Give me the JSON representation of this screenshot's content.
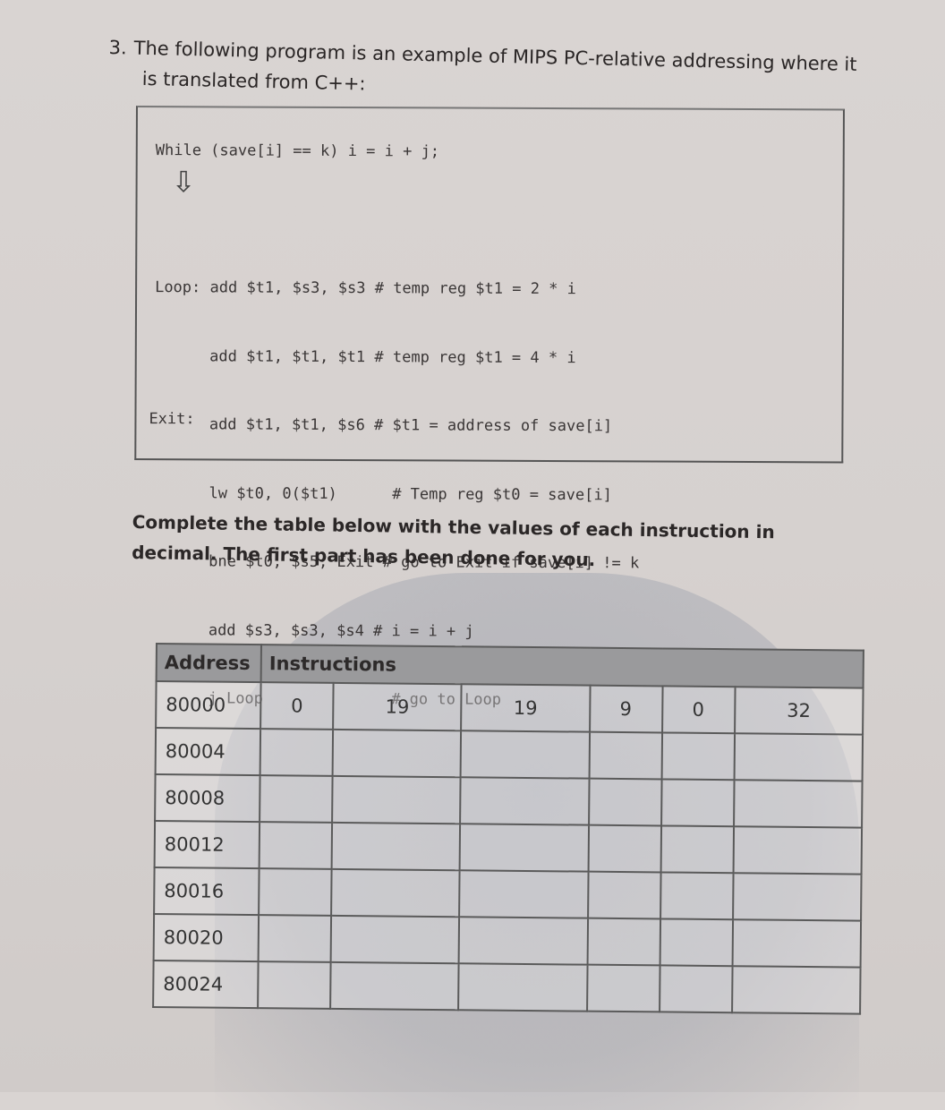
{
  "question": {
    "number": "3.",
    "line1": "The following program is an example of MIPS PC-relative addressing where it",
    "line2": "is translated from C++:"
  },
  "code": {
    "cpp": "While (save[i] == k) i = i + j;",
    "arrow_icon": "down-arrow",
    "asm_lines": [
      "Loop: add $t1, $s3, $s3 # temp reg $t1 = 2 * i",
      "      add $t1, $t1, $t1 # temp reg $t1 = 4 * i",
      "      add $t1, $t1, $s6 # $t1 = address of save[i]",
      "      lw $t0, 0($t1)      # Temp reg $t0 = save[i]",
      "      bne $t0, $s5, Exit # go to Exit if save[i] != k",
      "      add $s3, $s3, $s4 # i = i + j",
      "      j Loop              # go to Loop"
    ],
    "exit_label": "Exit:"
  },
  "instruction_text": "Complete the table below with the values of each instruction in decimal. The first part has been done for you.",
  "table": {
    "headers": [
      "Address",
      "Instructions"
    ],
    "rows": [
      {
        "address": "80000",
        "fields": [
          "0",
          "19",
          "19",
          "9",
          "0",
          "32"
        ]
      },
      {
        "address": "80004",
        "fields": [
          "",
          "",
          "",
          "",
          "",
          ""
        ]
      },
      {
        "address": "80008",
        "fields": [
          "",
          "",
          "",
          "",
          "",
          ""
        ]
      },
      {
        "address": "80012",
        "fields": [
          "",
          "",
          "",
          "",
          "",
          ""
        ]
      },
      {
        "address": "80016",
        "fields": [
          "",
          "",
          "",
          "",
          "",
          ""
        ]
      },
      {
        "address": "80020",
        "fields": [
          "",
          "",
          "",
          "",
          "",
          ""
        ]
      },
      {
        "address": "80024",
        "fields": [
          "",
          "",
          "",
          "",
          "",
          ""
        ]
      }
    ]
  }
}
